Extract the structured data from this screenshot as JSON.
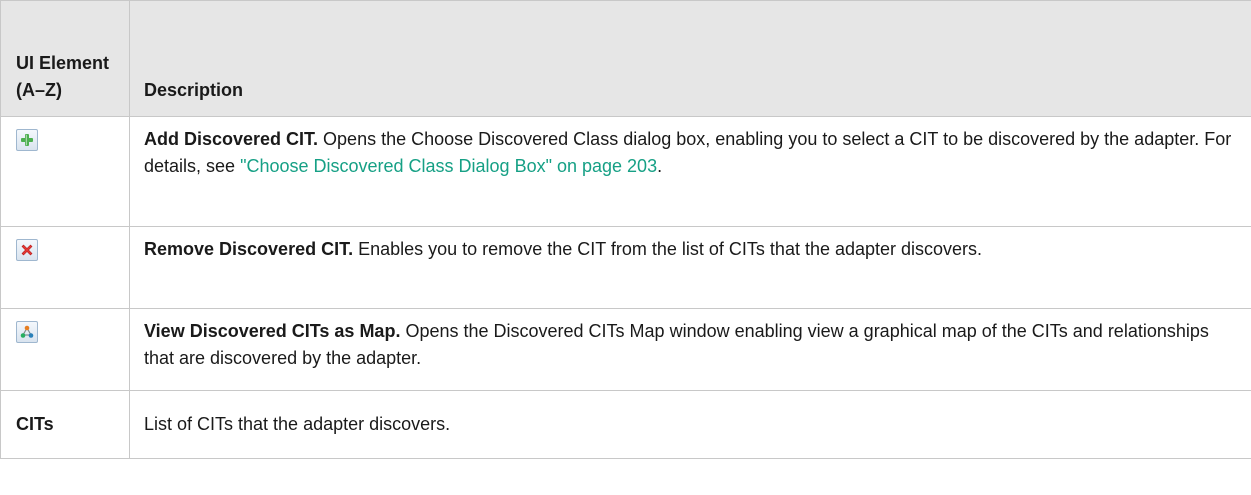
{
  "table": {
    "headers": {
      "element": "UI Element (A–Z)",
      "description": "Description"
    },
    "rows": [
      {
        "icon": "add-plus-icon",
        "term": "Add Discovered CIT.",
        "text": " Opens the Choose Discovered Class dialog box, enabling you to select a CIT to be discovered by the adapter. For details, see ",
        "link": "\"Choose Discovered Class Dialog Box\" on page 203",
        "after": "."
      },
      {
        "icon": "remove-x-icon",
        "term": "Remove Discovered CIT.",
        "text": " Enables you to remove the CIT from the list of CITs that the adapter discovers."
      },
      {
        "icon": "map-view-icon",
        "term": "View Discovered CITs as Map.",
        "text": " Opens the Discovered CITs Map window enabling view a graphical map of the CITs and relationships that are discovered by the adapter."
      },
      {
        "label": "CITs",
        "text": "List of CITs that the adapter discovers."
      }
    ]
  },
  "colors": {
    "header_bg": "#e6e6e6",
    "border": "#c8c8c8",
    "link": "#16a085",
    "add_icon": "#4caf50",
    "remove_icon": "#e53935",
    "map_icon": "#e67e22"
  }
}
